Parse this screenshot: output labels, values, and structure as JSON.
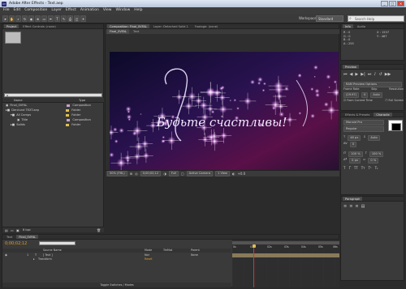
{
  "window": {
    "app_title": "Adobe After Effects - Text.aep",
    "btn_min": "_",
    "btn_max": "□",
    "btn_close": "✕"
  },
  "menus": [
    "File",
    "Edit",
    "Composition",
    "Layer",
    "Effect",
    "Animation",
    "View",
    "Window",
    "Help"
  ],
  "toolbar": {
    "workspace_label": "Workspace:",
    "workspace_value": "Standard",
    "search_placeholder": "Search Help"
  },
  "project": {
    "tabs": [
      "Project",
      "Effect Controls: (none)"
    ],
    "search_placeholder": "ρ",
    "col_name": "Name",
    "col_type": "Type",
    "items": [
      {
        "name": "Final_0VFAL",
        "type": "Composition",
        "color": "#c8a2c8",
        "indent": 0
      },
      {
        "name": "Derclund TEXT.aep",
        "type": "Folder",
        "color": "#e0c050",
        "indent": 0
      },
      {
        "name": "All Comps",
        "type": "Folder",
        "color": "#e0c050",
        "indent": 1
      },
      {
        "name": "Title",
        "type": "Composition",
        "color": "#c8a2c8",
        "indent": 2
      },
      {
        "name": "Solids",
        "type": "Folder",
        "color": "#e0c050",
        "indent": 1
      }
    ],
    "bpc": "8 bpc"
  },
  "composition": {
    "tabs": [
      "Composition: Final_0VFAL",
      "Layer: Detached Solid 1",
      "Footage: (none)"
    ],
    "subtabs": [
      "Final_0VFAL",
      "Text"
    ],
    "title_text": "Будьте счастливы!",
    "controls": {
      "zoom": "50% (FHL)",
      "time": "0;00;02;12",
      "resolution": "Full",
      "camera": "Active Camera",
      "views": "1 View",
      "offset": "+0.0"
    }
  },
  "info": {
    "tabs": [
      "Info",
      "Audio"
    ],
    "r": "R : 0",
    "g": "G : 0",
    "b": "B : 0",
    "a": "A : 255",
    "x": "X : 1537",
    "y": "Y : 467"
  },
  "preview": {
    "tab": "Preview",
    "options": "RAM Preview Options",
    "frame_rate_label": "Frame Rate",
    "skip_label": "Skip",
    "resolution_label": "Resolution",
    "frame_rate": "(29.97)",
    "skip": "0",
    "resolution": "Auto",
    "from_current": "From Current Time",
    "full_screen": "Full Screen"
  },
  "character": {
    "tabs": [
      "Effects & Presets",
      "Characte"
    ],
    "font": "Monaid Pro",
    "style": "Regular",
    "size": "48 px",
    "leading": "Auto",
    "tracking": "0",
    "scale_v": "100 %",
    "scale_h": "100 %",
    "baseline": "0 px",
    "tsume": "0 %",
    "toggles": [
      "T",
      "T",
      "TT",
      "Tт",
      "T¹",
      "T₁"
    ]
  },
  "paragraph": {
    "tab": "Paragraph"
  },
  "timeline": {
    "tabs": [
      "Text",
      "Final_0VFAL"
    ],
    "time": "0;00;02;12",
    "col_source": "Source Name",
    "col_mode": "Mode",
    "col_trkmat": "TrkMat",
    "col_parent": "Parent",
    "layer_num": "1",
    "layer_name": "[ Text ]",
    "layer_mode": "Nor",
    "parent": "None",
    "transform": "Transform",
    "reset": "Reset",
    "ruler": [
      "0s",
      "01s",
      "02s",
      "03s",
      "04s",
      "05s",
      "06s"
    ],
    "footer": "Toggle Switches / Modes",
    "playhead_fraction": 0.2
  }
}
